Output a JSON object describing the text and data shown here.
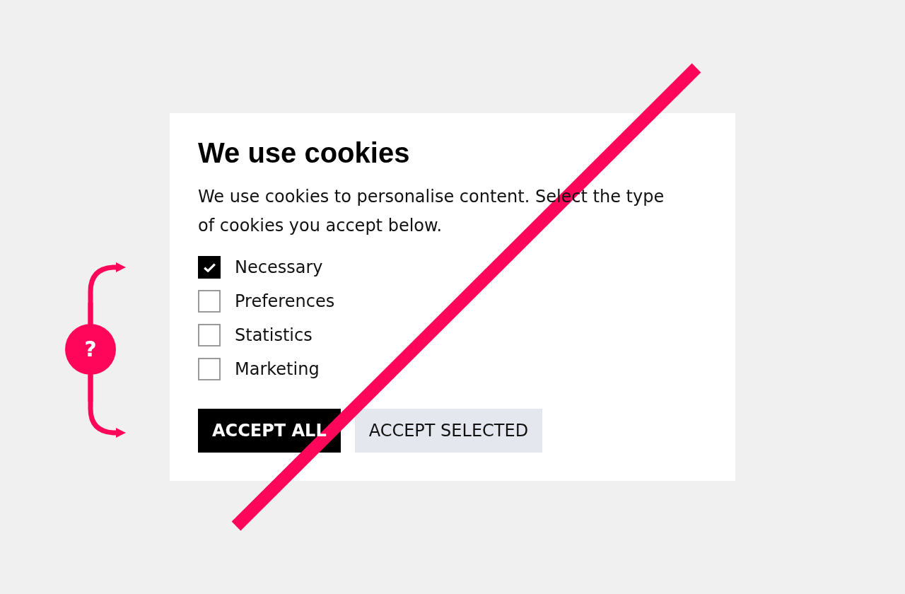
{
  "annotation": {
    "symbol": "?"
  },
  "dialog": {
    "title": "We use cookies",
    "message": "We use cookies to personalise content. Select the type of cookies you accept below.",
    "options": [
      {
        "label": "Necessary",
        "checked": true
      },
      {
        "label": "Preferences",
        "checked": false
      },
      {
        "label": "Statistics",
        "checked": false
      },
      {
        "label": "Marketing",
        "checked": false
      }
    ],
    "buttons": [
      {
        "label": "ACCEPT ALL",
        "kind": "primary"
      },
      {
        "label": "ACCEPT SELECTED",
        "kind": "secondary"
      }
    ],
    "crossed_out": true
  }
}
